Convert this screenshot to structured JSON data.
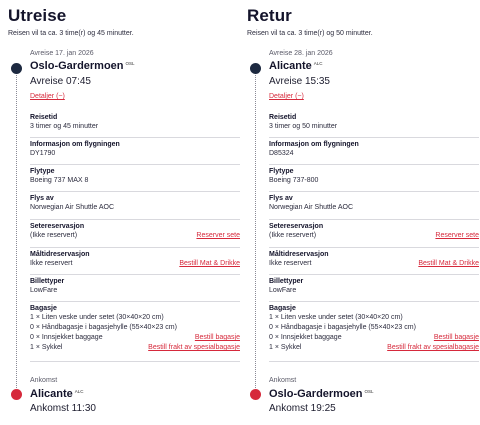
{
  "outbound": {
    "title": "Utreise",
    "duration_text": "Reisen vil ta ca. 3 time(r) og 45 minutter.",
    "departure_label": "Avreise 17. jan 2026",
    "origin_name": "Oslo-Gardermoen",
    "origin_code": "OSL",
    "departure_time": "Avreise 07:45",
    "details_link": "Detaljer (−)",
    "sections": [
      {
        "header": "Reisetid",
        "lines": [
          {
            "text": "3 timer og 45 minutter"
          }
        ]
      },
      {
        "header": "Informasjon om flygningen",
        "lines": [
          {
            "text": "DY1790"
          }
        ]
      },
      {
        "header": "Flytype",
        "lines": [
          {
            "text": "Boeing 737 MAX 8"
          }
        ]
      },
      {
        "header": "Flys av",
        "lines": [
          {
            "text": "Norwegian Air Shuttle AOC"
          }
        ]
      },
      {
        "header": "Setereservasjon",
        "lines": [
          {
            "text": "(Ikke reservert)",
            "link": "Reserver sete"
          }
        ]
      },
      {
        "header": "Måltidreservasjon",
        "lines": [
          {
            "text": "Ikke reservert",
            "link": "Bestill Mat & Drikke"
          }
        ]
      },
      {
        "header": "Billettyper",
        "lines": [
          {
            "text": "LowFare"
          }
        ]
      },
      {
        "header": "Bagasje",
        "lines": [
          {
            "text": "1 × Liten veske under setet (30×40×20 cm)"
          },
          {
            "text": "0 × Håndbagasje i bagasjehylle (55×40×23 cm)"
          },
          {
            "text": "0 × Innsjekket baggage",
            "link": "Bestill bagasje"
          },
          {
            "text": "1 × Sykkel",
            "link": "Bestill frakt av spesialbagasje"
          }
        ]
      }
    ],
    "arrival_label": "Ankomst",
    "destination_name": "Alicante",
    "destination_code": "ALC",
    "arrival_time": "Ankomst 11:30"
  },
  "return": {
    "title": "Retur",
    "duration_text": "Reisen vil ta ca. 3 time(r) og 50 minutter.",
    "departure_label": "Avreise 28. jan 2026",
    "origin_name": "Alicante",
    "origin_code": "ALC",
    "departure_time": "Avreise 15:35",
    "details_link": "Detaljer (−)",
    "sections": [
      {
        "header": "Reisetid",
        "lines": [
          {
            "text": "3 timer og 50 minutter"
          }
        ]
      },
      {
        "header": "Informasjon om flygningen",
        "lines": [
          {
            "text": "D85324"
          }
        ]
      },
      {
        "header": "Flytype",
        "lines": [
          {
            "text": "Boeing 737-800"
          }
        ]
      },
      {
        "header": "Flys av",
        "lines": [
          {
            "text": "Norwegian Air Shuttle AOC"
          }
        ]
      },
      {
        "header": "Setereservasjon",
        "lines": [
          {
            "text": "(Ikke reservert)",
            "link": "Reserver sete"
          }
        ]
      },
      {
        "header": "Måltidreservasjon",
        "lines": [
          {
            "text": "Ikke reservert",
            "link": "Bestill Mat & Drikke"
          }
        ]
      },
      {
        "header": "Billettyper",
        "lines": [
          {
            "text": "LowFare"
          }
        ]
      },
      {
        "header": "Bagasje",
        "lines": [
          {
            "text": "1 × Liten veske under setet (30×40×20 cm)"
          },
          {
            "text": "0 × Håndbagasje i bagasjehylle (55×40×23 cm)"
          },
          {
            "text": "0 × Innsjekket baggage",
            "link": "Bestill bagasje"
          },
          {
            "text": "1 × Sykkel",
            "link": "Bestill frakt av spesialbagasje"
          }
        ]
      }
    ],
    "arrival_label": "Ankomst",
    "destination_name": "Oslo-Gardermoen",
    "destination_code": "OSL",
    "arrival_time": "Ankomst 19:25"
  }
}
